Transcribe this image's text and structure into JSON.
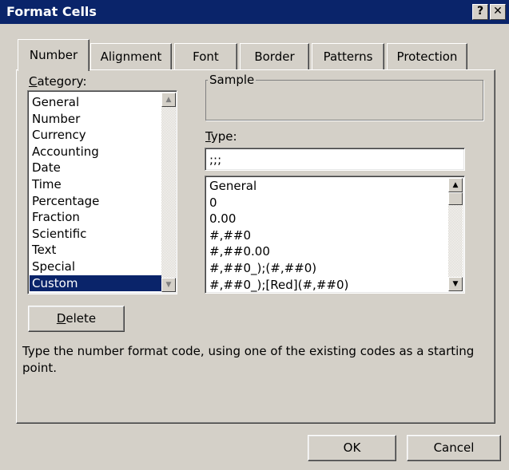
{
  "window": {
    "title": "Format Cells",
    "help_glyph": "?",
    "close_glyph": "✕"
  },
  "tabs": [
    {
      "label": "Number",
      "active": true
    },
    {
      "label": "Alignment",
      "active": false
    },
    {
      "label": "Font",
      "active": false
    },
    {
      "label": "Border",
      "active": false
    },
    {
      "label": "Patterns",
      "active": false
    },
    {
      "label": "Protection",
      "active": false
    }
  ],
  "category": {
    "label_hotkey": "C",
    "label_rest": "ategory:",
    "items": [
      "General",
      "Number",
      "Currency",
      "Accounting",
      "Date",
      "Time",
      "Percentage",
      "Fraction",
      "Scientific",
      "Text",
      "Special",
      "Custom"
    ],
    "selected": "Custom"
  },
  "sample": {
    "label": "Sample",
    "value": ""
  },
  "type": {
    "label_hotkey": "T",
    "label_rest": "ype:",
    "value": ";;;",
    "items": [
      "General",
      "0",
      "0.00",
      "#,##0",
      "#,##0.00",
      "#,##0_);(#,##0)",
      "#,##0_);[Red](#,##0)"
    ]
  },
  "delete_button": {
    "hotkey": "D",
    "rest": "elete"
  },
  "hint_text": "Type the number format code, using one of the existing codes as a starting point.",
  "buttons": {
    "ok": "OK",
    "cancel": "Cancel"
  },
  "icons": {
    "scroll_up": "▲",
    "scroll_down": "▼"
  }
}
